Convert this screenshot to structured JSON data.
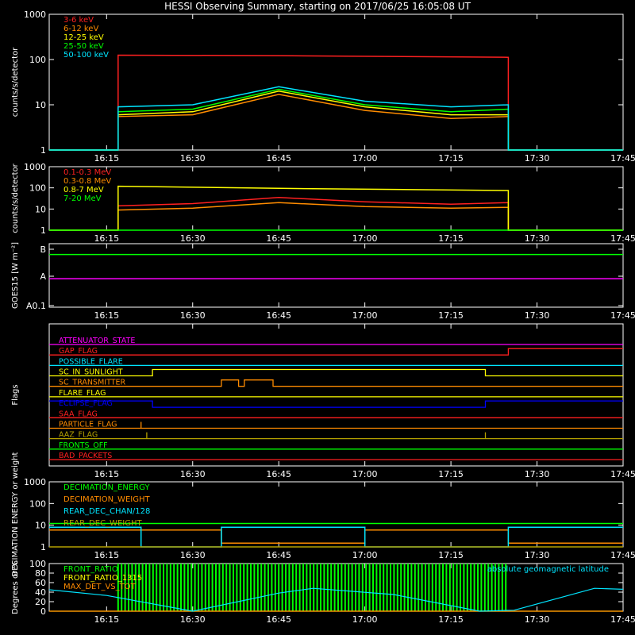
{
  "title": "HESSI Observing Summary, starting on 2017/06/25 16:05:08 UT",
  "colors": {
    "background": "#000000",
    "axes": "#ffffff",
    "red": "#ff2020",
    "orange": "#ff8c00",
    "yellow": "#ffff00",
    "green": "#00ff00",
    "cyan": "#00e5ff",
    "magenta": "#ff00ff",
    "blue": "#0000ff",
    "olive": "#b4a000"
  },
  "chart_data": [
    {
      "type": "line",
      "ylabel": "counts/s/detector",
      "yscale": "log",
      "ylim": [
        1,
        1000
      ],
      "ytick_labels": [
        "1",
        "10",
        "100",
        "1000"
      ],
      "xlim": [
        "16:05",
        "17:45"
      ],
      "xtick_labels": [
        "16:15",
        "16:30",
        "16:45",
        "17:00",
        "17:15",
        "17:30",
        "17:45"
      ],
      "legend": "top-left",
      "series": [
        {
          "name": "3-6 keV",
          "color": "#ff2020",
          "x": [
            "16:05",
            "16:17",
            "16:17",
            "16:45",
            "17:25",
            "17:25",
            "17:45"
          ],
          "y": [
            1,
            1,
            125,
            122,
            112,
            1,
            1
          ]
        },
        {
          "name": "6-12 keV",
          "color": "#ff8c00",
          "x": [
            "16:05",
            "16:17",
            "16:17",
            "16:30",
            "16:45",
            "17:00",
            "17:15",
            "17:25",
            "17:25",
            "17:45"
          ],
          "y": [
            1,
            1,
            5.5,
            6,
            17,
            7.5,
            5,
            5.5,
            1,
            1
          ]
        },
        {
          "name": "12-25 keV",
          "color": "#ffff00",
          "x": [
            "16:05",
            "16:17",
            "16:17",
            "16:30",
            "16:45",
            "17:00",
            "17:15",
            "17:25",
            "17:25",
            "17:45"
          ],
          "y": [
            1,
            1,
            6,
            7,
            20,
            9,
            6,
            6,
            1,
            1
          ]
        },
        {
          "name": "25-50 keV",
          "color": "#00ff00",
          "x": [
            "16:05",
            "16:17",
            "16:17",
            "16:30",
            "16:45",
            "17:00",
            "17:15",
            "17:25",
            "17:25",
            "17:45"
          ],
          "y": [
            1,
            1,
            7,
            8,
            22,
            10,
            7,
            8,
            1,
            1
          ]
        },
        {
          "name": "50-100 keV",
          "color": "#00e5ff",
          "x": [
            "16:05",
            "16:17",
            "16:17",
            "16:30",
            "16:45",
            "17:00",
            "17:15",
            "17:25",
            "17:25",
            "17:45"
          ],
          "y": [
            1,
            1,
            9,
            10,
            25,
            12,
            9,
            10,
            1,
            1
          ]
        }
      ]
    },
    {
      "type": "line",
      "ylabel": "counts/s/detector",
      "yscale": "log",
      "ylim": [
        1,
        1000
      ],
      "ytick_labels": [
        "1",
        "10",
        "100",
        "1000"
      ],
      "xlim": [
        "16:05",
        "17:45"
      ],
      "xtick_labels": [
        "16:15",
        "16:30",
        "16:45",
        "17:00",
        "17:15",
        "17:30",
        "17:45"
      ],
      "legend": "top-left",
      "series": [
        {
          "name": "0.1-0.3 MeV",
          "color": "#ff2020",
          "x": [
            "16:05",
            "16:17",
            "16:17",
            "16:30",
            "16:45",
            "17:00",
            "17:15",
            "17:25",
            "17:25",
            "17:45"
          ],
          "y": [
            1,
            1,
            14,
            18,
            35,
            22,
            17,
            20,
            1,
            1
          ]
        },
        {
          "name": "0.3-0.8 MeV",
          "color": "#ff8c00",
          "x": [
            "16:05",
            "16:17",
            "16:17",
            "16:30",
            "16:45",
            "17:00",
            "17:15",
            "17:25",
            "17:25",
            "17:45"
          ],
          "y": [
            1,
            1,
            9,
            11,
            20,
            13,
            11,
            12,
            1,
            1
          ]
        },
        {
          "name": "0.8-7 MeV",
          "color": "#ffff00",
          "x": [
            "16:05",
            "16:17",
            "16:17",
            "16:45",
            "17:25",
            "17:25",
            "17:45"
          ],
          "y": [
            1,
            1,
            120,
            95,
            75,
            1,
            1
          ]
        },
        {
          "name": "7-20 MeV",
          "color": "#00ff00",
          "x": [
            "16:05",
            "17:45"
          ],
          "y": [
            1,
            1
          ]
        }
      ]
    },
    {
      "type": "line",
      "ylabel": "GOES15 [W m⁻²]",
      "yscale": "log",
      "ytick_labels": [
        "A0.1",
        "A",
        "B"
      ],
      "xlim": [
        "16:05",
        "17:45"
      ],
      "xtick_labels": [
        "16:15",
        "16:30",
        "16:45",
        "17:00",
        "17:15",
        "17:30",
        "17:45"
      ],
      "series": [
        {
          "color": "#00ff00",
          "x": [
            "16:05",
            "17:45"
          ],
          "y": [
            6.5e-08,
            6.5e-08
          ]
        },
        {
          "color": "#ff00ff",
          "x": [
            "16:05",
            "17:45"
          ],
          "y": [
            9e-09,
            9e-09
          ]
        }
      ]
    },
    {
      "type": "line",
      "ylabel": "Flags",
      "xlim": [
        "16:05",
        "17:45"
      ],
      "xtick_labels": [
        "16:15",
        "16:30",
        "16:45",
        "17:00",
        "17:15",
        "17:30",
        "17:45"
      ],
      "series": [
        {
          "name": "ATTENUATOR_STATE",
          "color": "#ff00ff",
          "x": [
            "16:05",
            "17:45"
          ],
          "y": [
            0,
            0
          ]
        },
        {
          "name": "GAP_FLAG",
          "color": "#ff2020",
          "x": [
            "16:05",
            "17:25",
            "17:25",
            "17:45"
          ],
          "y": [
            0,
            0,
            1,
            1
          ]
        },
        {
          "name": "POSSIBLE_FLARE",
          "color": "#00e5ff",
          "x": [
            "16:05",
            "17:45"
          ],
          "y": [
            0,
            0
          ]
        },
        {
          "name": "SC_IN_SUNLIGHT",
          "color": "#ffff00",
          "x": [
            "16:05",
            "16:23",
            "16:23",
            "17:21",
            "17:21",
            "17:45"
          ],
          "y": [
            0,
            0,
            1,
            1,
            0,
            0
          ]
        },
        {
          "name": "SC_TRANSMITTER",
          "color": "#ff8c00",
          "x": [
            "16:05",
            "16:35",
            "16:35",
            "16:38",
            "16:38",
            "16:39",
            "16:39",
            "16:44",
            "16:44",
            "17:45"
          ],
          "y": [
            0,
            0,
            1,
            1,
            0,
            0,
            1,
            1,
            0,
            0
          ]
        },
        {
          "name": "FLARE_FLAG",
          "color": "#ffff00",
          "x": [
            "16:05",
            "17:45"
          ],
          "y": [
            0,
            0
          ]
        },
        {
          "name": "ECLIPSE_FLAG",
          "color": "#0000ff",
          "x": [
            "16:05",
            "16:23",
            "16:23",
            "17:21",
            "17:21",
            "17:45"
          ],
          "y": [
            1,
            1,
            0,
            0,
            1,
            1
          ]
        },
        {
          "name": "SAA_FLAG",
          "color": "#ff2020",
          "x": [
            "16:05",
            "17:45"
          ],
          "y": [
            0,
            0
          ]
        },
        {
          "name": "PARTICLE_FLAG",
          "color": "#ff8c00",
          "x": [
            "16:05",
            "16:21",
            "16:21",
            "16:21",
            "16:21",
            "17:45"
          ],
          "y": [
            0,
            0,
            1,
            1,
            0,
            0
          ]
        },
        {
          "name": "AAZ_FLAG",
          "color": "#b4a000",
          "x": [
            "16:05",
            "16:22",
            "16:22",
            "16:22",
            "16:22",
            "17:21",
            "17:21",
            "17:21",
            "17:21",
            "17:45"
          ],
          "y": [
            0,
            0,
            1,
            1,
            0,
            0,
            1,
            1,
            0,
            0
          ]
        },
        {
          "name": "FRONTS_OFF",
          "color": "#00ff00",
          "x": [
            "16:05",
            "17:45"
          ],
          "y": [
            0,
            0
          ]
        },
        {
          "name": "BAD_PACKETS",
          "color": "#ff2020",
          "x": [
            "16:05",
            "17:45"
          ],
          "y": [
            0,
            0
          ]
        }
      ]
    },
    {
      "type": "line",
      "ylabel": "DECIMATION ENERGY or weight",
      "yscale": "log",
      "ylim": [
        1,
        1000
      ],
      "ytick_labels": [
        "1",
        "10",
        "100",
        "1000"
      ],
      "xlim": [
        "16:05",
        "17:45"
      ],
      "xtick_labels": [
        "16:15",
        "16:30",
        "16:45",
        "17:00",
        "17:15",
        "17:30",
        "17:45"
      ],
      "legend": "top-left",
      "series": [
        {
          "name": "DECIMATION_ENERGY",
          "color": "#00ff00",
          "x": [
            "16:05",
            "17:45"
          ],
          "y": [
            12,
            12
          ]
        },
        {
          "name": "DECIMATION_WEIGHT",
          "color": "#ff8c00",
          "x": [
            "16:05",
            "16:35",
            "16:35",
            "17:00",
            "17:00",
            "17:25",
            "17:25",
            "17:45"
          ],
          "y": [
            6,
            6,
            1.5,
            1.5,
            6,
            6,
            1.5,
            1.5
          ]
        },
        {
          "name": "REAR_DEC_CHAN/128",
          "color": "#00e5ff",
          "x": [
            "16:05",
            "16:21",
            "16:21",
            "16:35",
            "16:35",
            "17:00",
            "17:00",
            "17:25",
            "17:25",
            "17:45"
          ],
          "y": [
            8,
            8,
            1,
            1,
            8,
            8,
            1,
            1,
            8,
            8
          ]
        },
        {
          "name": "REAR_DEC_WEIGHT",
          "color": "#b4a000",
          "x": [
            "16:05",
            "17:45"
          ],
          "y": [
            1,
            1
          ]
        }
      ]
    },
    {
      "type": "line",
      "ylabel": "Degrees or %",
      "ylim": [
        0,
        100
      ],
      "ytick_labels": [
        "0",
        "20",
        "40",
        "60",
        "80",
        "100"
      ],
      "xlim": [
        "16:05",
        "17:45"
      ],
      "xtick_labels": [
        "16:15",
        "16:30",
        "16:45",
        "17:00",
        "17:15",
        "17:30",
        "17:45"
      ],
      "legend": "top-left",
      "annotation": "absolute geomagnetic latitude",
      "series": [
        {
          "name": "FRONT_RATIO",
          "color": "#00ff00",
          "x": [
            "16:17",
            "17:25"
          ],
          "y": [
            100,
            100
          ]
        },
        {
          "name": "FRONT_RATIO_1315",
          "color": "#ffff00",
          "x": [
            "16:05",
            "17:45"
          ],
          "y": [
            0,
            0
          ]
        },
        {
          "name": "MAX_DET_VS_TOT",
          "color": "#ff8c00",
          "x": [
            "16:05",
            "17:45"
          ],
          "y": [
            0,
            0
          ]
        },
        {
          "name": "absolute geomagnetic latitude",
          "color": "#00e5ff",
          "x": [
            "16:05",
            "16:15",
            "16:30",
            "16:45",
            "16:51",
            "17:05",
            "17:20",
            "17:26",
            "17:40",
            "17:45"
          ],
          "y": [
            45,
            33,
            0,
            38,
            48,
            35,
            0,
            2,
            48,
            46
          ]
        }
      ]
    }
  ]
}
